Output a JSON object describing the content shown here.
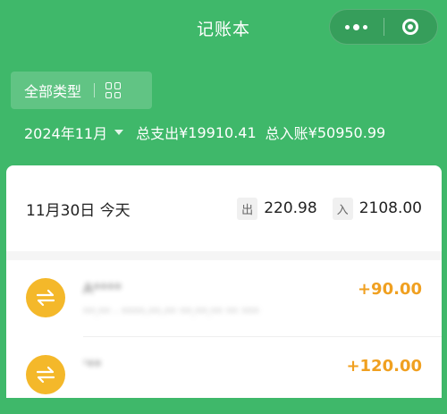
{
  "header": {
    "title": "记账本",
    "more_icon": "more-dots-icon",
    "close_icon": "target-close-icon"
  },
  "filter": {
    "label": "全部类型",
    "icon": "grid-icon"
  },
  "summary": {
    "month": "2024年11月",
    "expense_label": "总支出",
    "expense_value": "¥19910.41",
    "income_label": "总入账",
    "income_value": "¥50950.99"
  },
  "day": {
    "label": "11月30日 今天",
    "out_tag": "出",
    "out_value": "220.98",
    "in_tag": "入",
    "in_value": "2108.00"
  },
  "transactions": [
    {
      "name": "A****",
      "desc": "**:** · ****-**-** **:**:** ** ***",
      "amount": "+90.00",
      "icon": "transfer-arrows-icon"
    },
    {
      "name": "'**",
      "desc": "",
      "amount": "+120.00",
      "icon": "transfer-arrows-icon"
    }
  ],
  "colors": {
    "brand": "#3fb86a",
    "amount": "#f0a020",
    "avatar": "#f4b82a"
  }
}
